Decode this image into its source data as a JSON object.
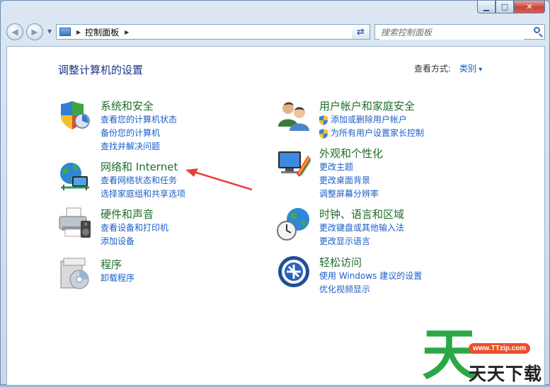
{
  "address": {
    "breadcrumb": "控制面板"
  },
  "search": {
    "placeholder": "搜索控制面板"
  },
  "header": {
    "title": "调整计算机的设置",
    "view_by_label": "查看方式:",
    "view_by_value": "类别"
  },
  "categories": [
    {
      "title": "系统和安全",
      "links": [
        "查看您的计算机状态",
        "备份您的计算机",
        "查找并解决问题"
      ]
    },
    {
      "title": "网络和 Internet",
      "links": [
        "查看网络状态和任务",
        "选择家庭组和共享选项"
      ]
    },
    {
      "title": "硬件和声音",
      "links": [
        "查看设备和打印机",
        "添加设备"
      ]
    },
    {
      "title": "程序",
      "links": [
        "卸载程序"
      ]
    },
    {
      "title": "用户帐户和家庭安全",
      "links": [
        "添加或删除用户帐户",
        "为所有用户设置家长控制"
      ]
    },
    {
      "title": "外观和个性化",
      "links": [
        "更改主题",
        "更改桌面背景",
        "调整屏幕分辨率"
      ]
    },
    {
      "title": "时钟、语言和区域",
      "links": [
        "更改键盘或其他输入法",
        "更改显示语言"
      ]
    },
    {
      "title": "轻松访问",
      "links": [
        "使用 Windows 建议的设置",
        "优化视频显示"
      ]
    }
  ],
  "watermark": {
    "url": "www.TTzip.com",
    "logo_char": "天",
    "brand": "天天下载"
  },
  "colors": {
    "title_blue": "#1e3287",
    "category_green": "#1e6d2b",
    "link_blue": "#1c5ec5",
    "arrow_red": "#e8413a"
  }
}
